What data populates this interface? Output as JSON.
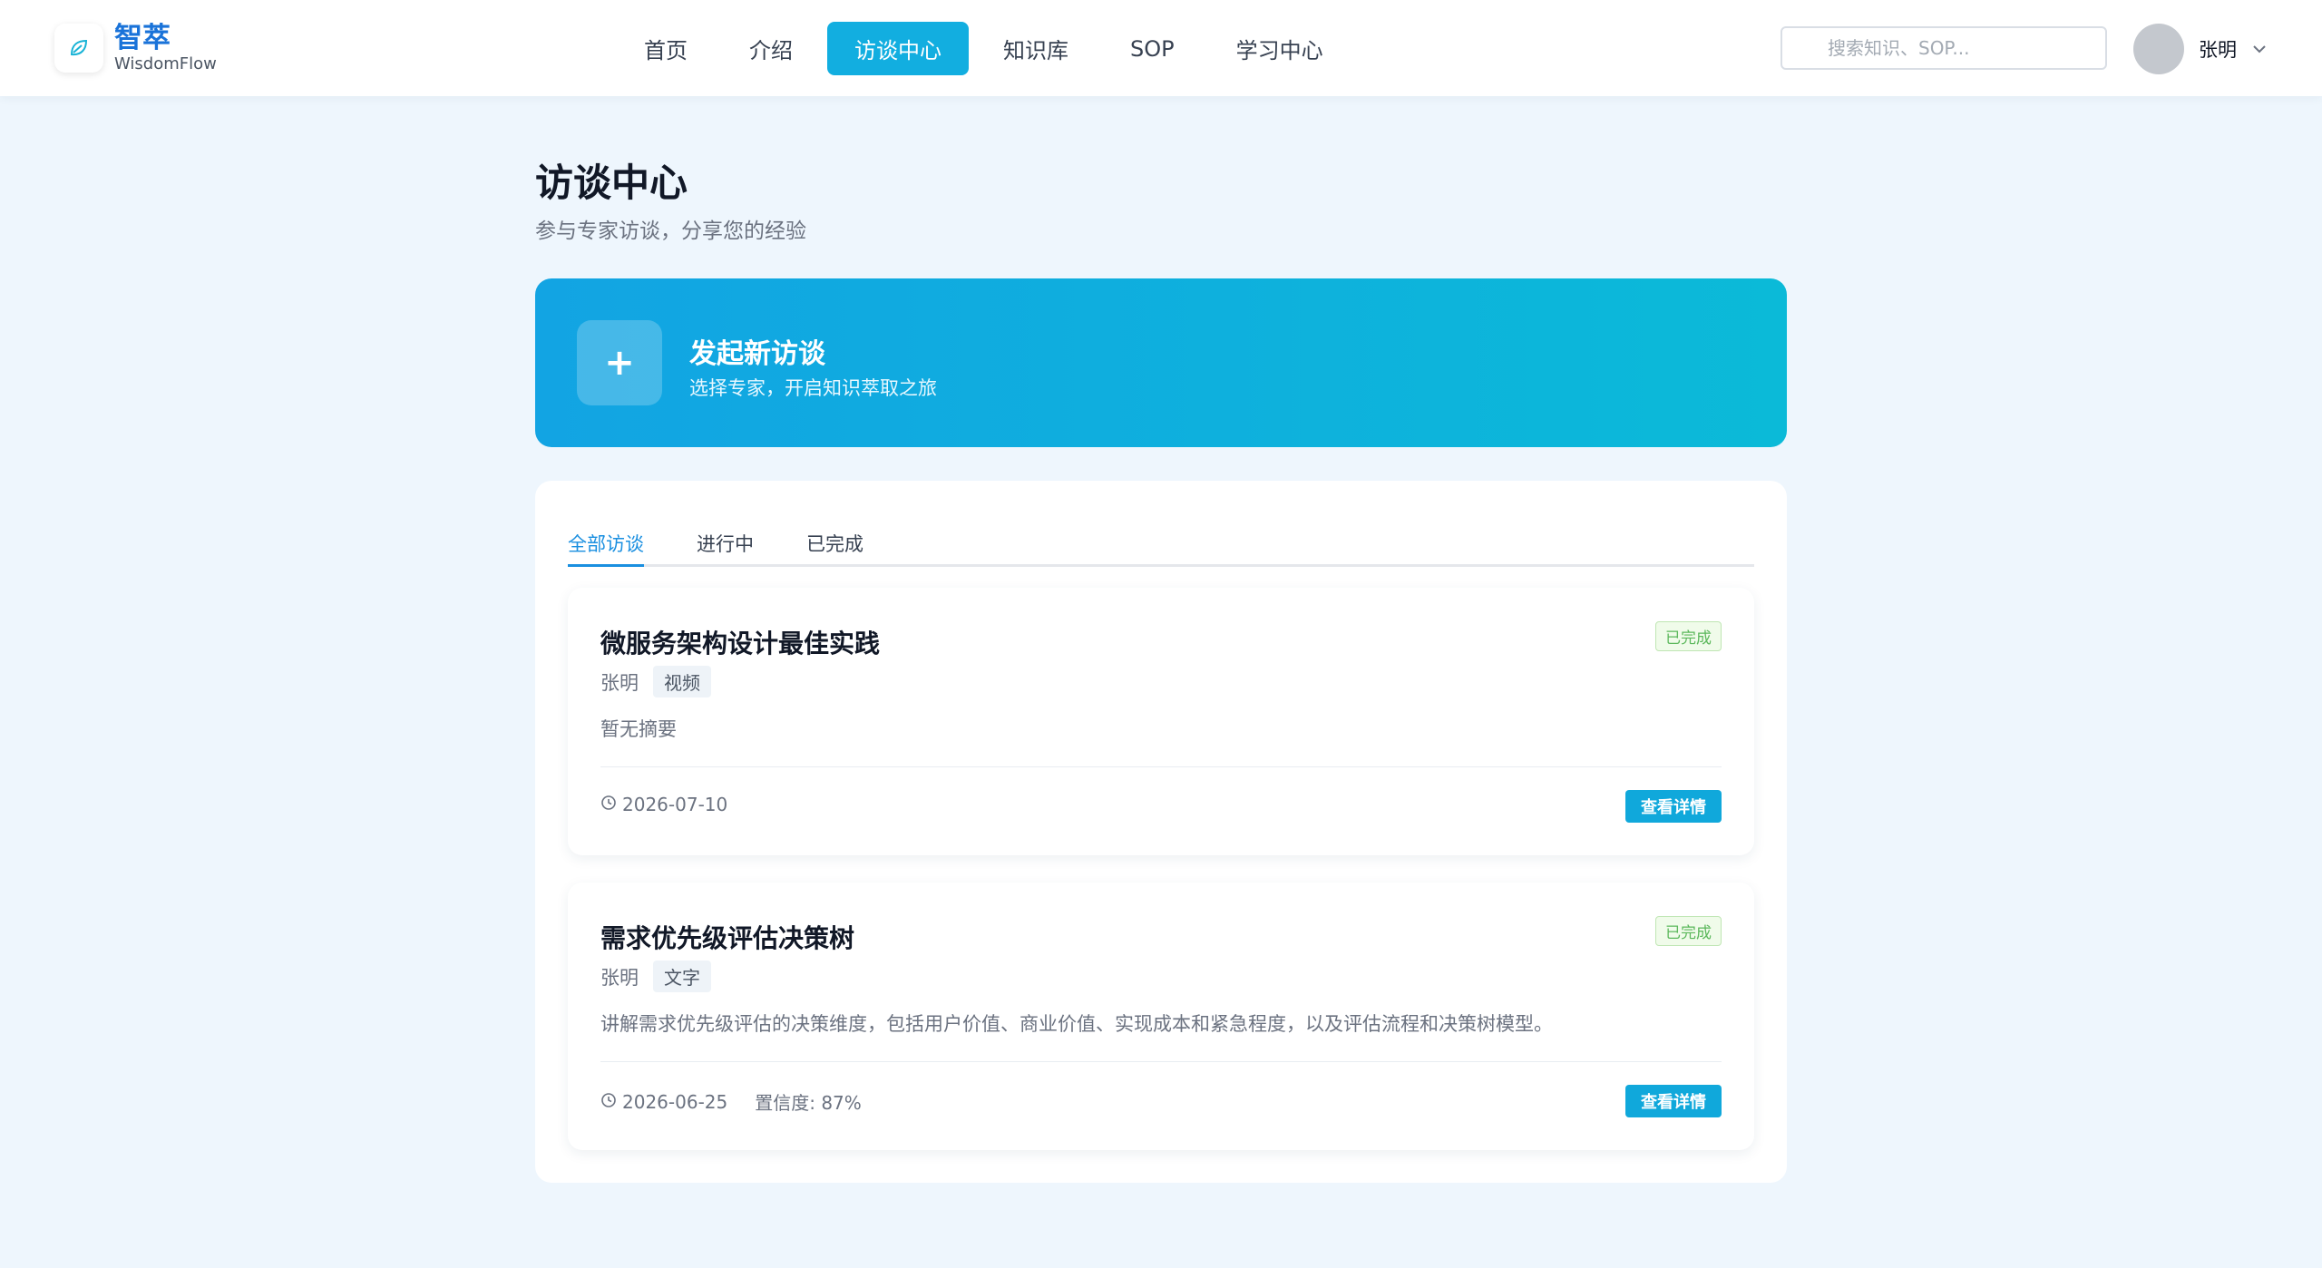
{
  "brand": {
    "name": "智萃",
    "subtitle": "WisdomFlow"
  },
  "nav": {
    "items": [
      {
        "label": "首页"
      },
      {
        "label": "介绍"
      },
      {
        "label": "访谈中心",
        "active": true
      },
      {
        "label": "知识库"
      },
      {
        "label": "SOP"
      },
      {
        "label": "学习中心"
      }
    ]
  },
  "search": {
    "placeholder": "搜索知识、SOP..."
  },
  "user": {
    "name": "张明"
  },
  "page": {
    "title": "访谈中心",
    "subtitle": "参与专家访谈，分享您的经验"
  },
  "banner": {
    "icon": "plus-icon",
    "title": "发起新访谈",
    "subtitle": "选择专家，开启知识萃取之旅"
  },
  "tabs": [
    {
      "label": "全部访谈",
      "active": true
    },
    {
      "label": "进行中"
    },
    {
      "label": "已完成"
    }
  ],
  "interviews": [
    {
      "title": "微服务架构设计最佳实践",
      "status": "已完成",
      "author": "张明",
      "type": "视频",
      "summary": "暂无摘要",
      "date": "2026-07-10",
      "confidence": "",
      "action_label": "查看详情"
    },
    {
      "title": "需求优先级评估决策树",
      "status": "已完成",
      "author": "张明",
      "type": "文字",
      "summary": "讲解需求优先级评估的决策维度，包括用户价值、商业价值、实现成本和紧急程度，以及评估流程和决策树模型。",
      "date": "2026-06-25",
      "confidence": "置信度: 87%",
      "action_label": "查看详情"
    }
  ],
  "colors": {
    "accent": "#12aee0",
    "brand": "#1a73d9",
    "status_done": "#5cb85c",
    "page_bg": "#eef6fd"
  }
}
